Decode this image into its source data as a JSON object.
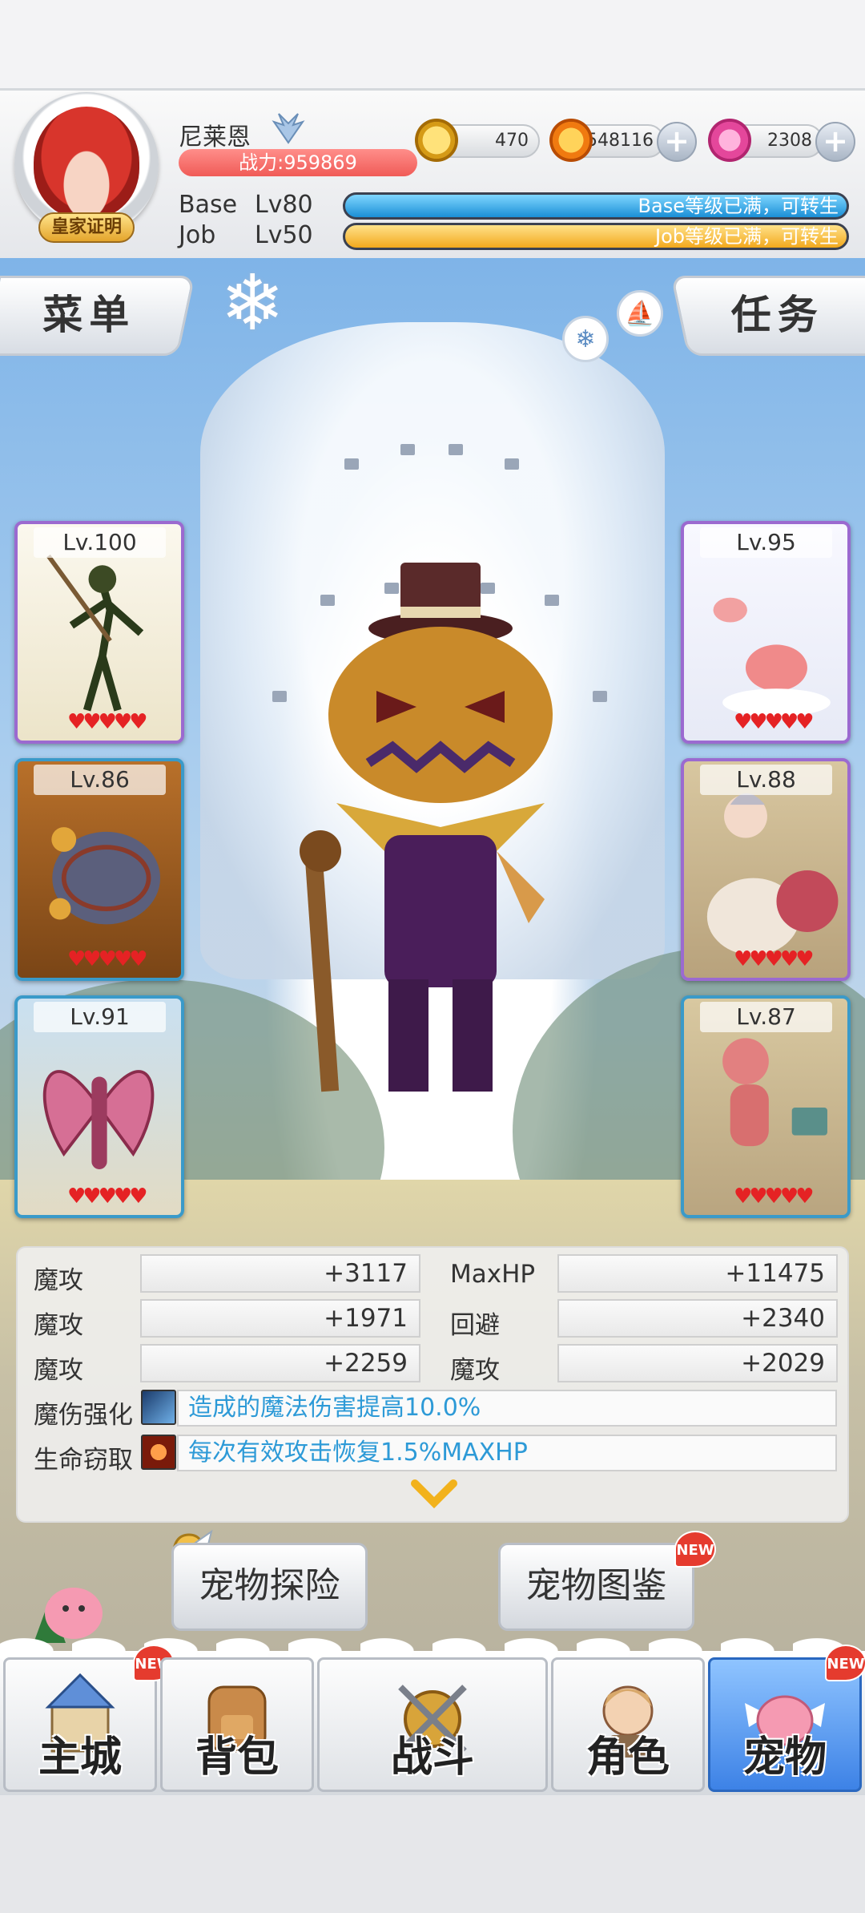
{
  "player": {
    "name": "尼莱恩",
    "badge": "皇家证明",
    "power": "战力:959869",
    "base_label": "Base",
    "base_level": "Lv80",
    "base_status": "Base等级已满，可转生",
    "job_label": "Job",
    "job_level": "Lv50",
    "job_status": "Job等级已满，可转生"
  },
  "currency": {
    "zeny": "470",
    "gold": "548116",
    "gem": "2308",
    "plus": "+"
  },
  "menus": {
    "left": "菜单",
    "right": "任务"
  },
  "pets": {
    "left": [
      {
        "level": "Lv.100",
        "hearts": "♥♥♥♥♥"
      },
      {
        "level": "Lv.86",
        "hearts": "♥♥♥♥♥"
      },
      {
        "level": "Lv.91",
        "hearts": "♥♥♥♥♥"
      }
    ],
    "right": [
      {
        "level": "Lv.95",
        "hearts": "♥♥♥♥♥"
      },
      {
        "level": "Lv.88",
        "hearts": "♥♥♥♥♥"
      },
      {
        "level": "Lv.87",
        "hearts": "♥♥♥♥♥"
      }
    ]
  },
  "stats": [
    {
      "label": "魔攻",
      "value": "+3117"
    },
    {
      "label": "MaxHP",
      "value": "+11475"
    },
    {
      "label": "魔攻",
      "value": "+1971"
    },
    {
      "label": "回避",
      "value": "+2340"
    },
    {
      "label": "魔攻",
      "value": "+2259"
    },
    {
      "label": "魔攻",
      "value": "+2029"
    }
  ],
  "skills": [
    {
      "label": "魔伤强化",
      "desc": "造成的魔法伤害提高10.0%"
    },
    {
      "label": "生命窃取",
      "desc": "每次有效攻击恢复1.5%MAXHP"
    }
  ],
  "actions": {
    "explore": "宠物探险",
    "codex": "宠物图鉴",
    "new": "NEW"
  },
  "nav": [
    {
      "label": "主城",
      "new": "NEW"
    },
    {
      "label": "背包"
    },
    {
      "label": "战斗"
    },
    {
      "label": "角色"
    },
    {
      "label": "宠物",
      "new": "NEW"
    }
  ],
  "colors": {
    "active_nav": "#3d82e6",
    "power_bar": "#f05b57",
    "base_bar": "#1b8fd6",
    "job_bar": "#f2a81c",
    "skill_text": "#2d9ad7"
  }
}
